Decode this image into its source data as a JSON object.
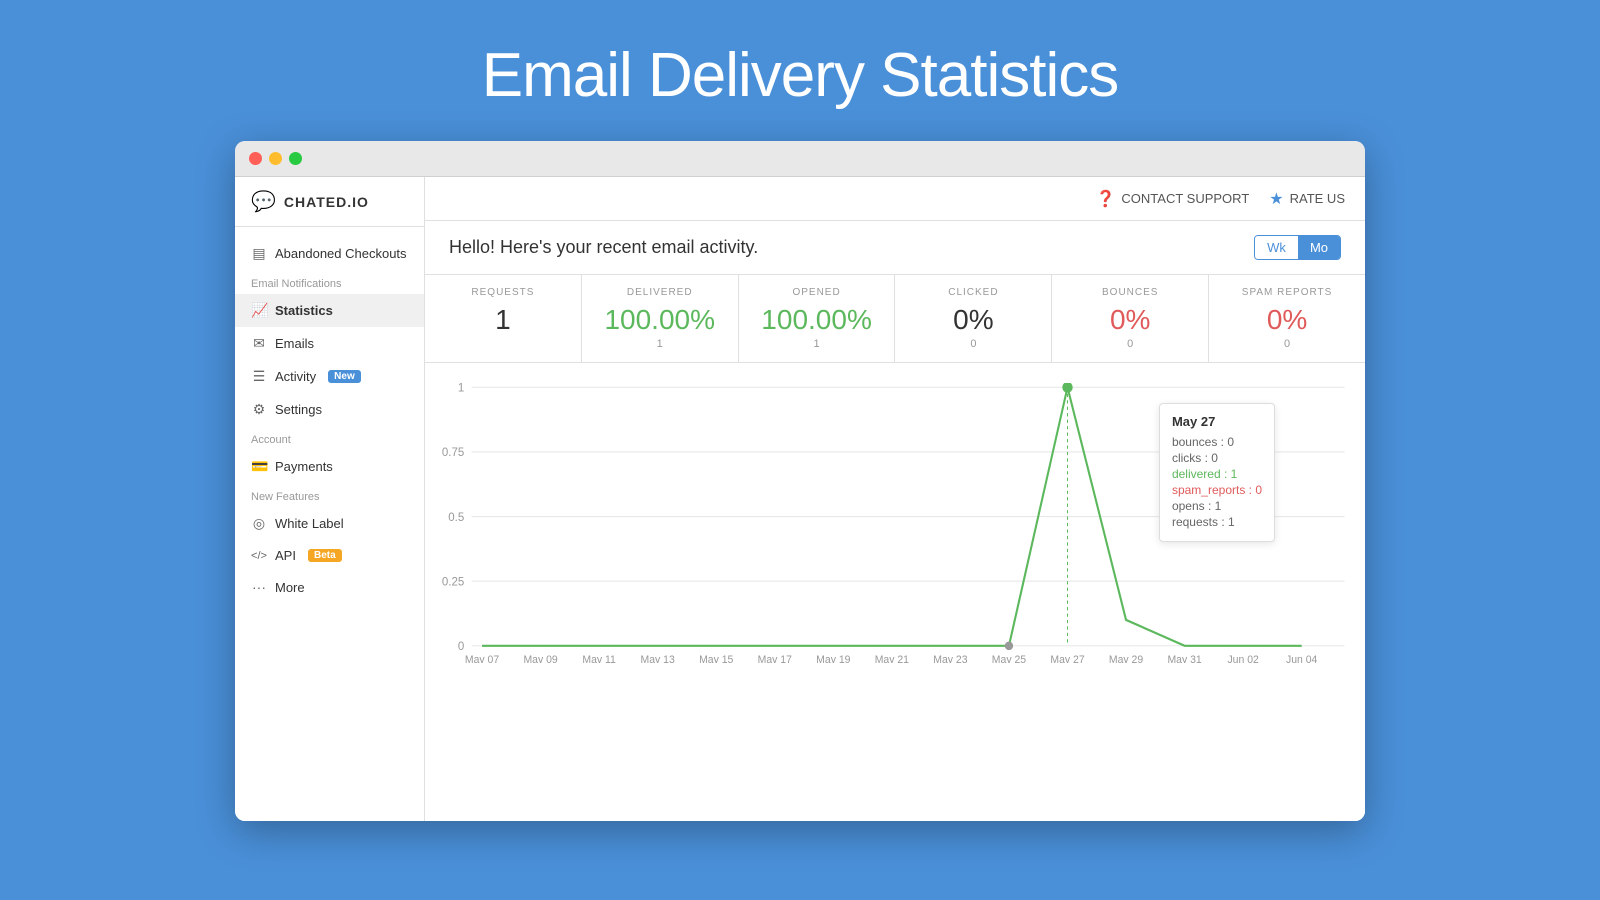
{
  "page": {
    "title": "Email Delivery Statistics"
  },
  "titlebar": {
    "lights": [
      "red",
      "yellow",
      "green"
    ]
  },
  "header": {
    "logo_text": "CHATED.IO",
    "contact_support_label": "CONTACT SUPPORT",
    "rate_us_label": "RATE US"
  },
  "sidebar": {
    "section_email": "Email Notifications",
    "section_account": "Account",
    "section_new_features": "New Features",
    "items": [
      {
        "id": "abandoned-checkouts",
        "label": "Abandoned Checkouts",
        "icon": "▤"
      },
      {
        "id": "statistics",
        "label": "Statistics",
        "icon": "📈",
        "active": true
      },
      {
        "id": "emails",
        "label": "Emails",
        "icon": "✉"
      },
      {
        "id": "activity",
        "label": "Activity",
        "icon": "☰",
        "badge": "New"
      },
      {
        "id": "settings",
        "label": "Settings",
        "icon": "⚙"
      },
      {
        "id": "payments",
        "label": "Payments",
        "icon": "💳"
      },
      {
        "id": "white-label",
        "label": "White Label",
        "icon": "◎"
      },
      {
        "id": "api",
        "label": "API",
        "icon": "</>",
        "badge": "Beta"
      },
      {
        "id": "more",
        "label": "More",
        "icon": "···"
      }
    ]
  },
  "content": {
    "greeting": "Hello! Here's your recent email activity.",
    "period_wk": "Wk",
    "period_mo": "Mo",
    "stats": [
      {
        "label": "REQUESTS",
        "value": "1",
        "sub": "",
        "color": "normal"
      },
      {
        "label": "DELIVERED",
        "value": "100.00%",
        "sub": "1",
        "color": "green"
      },
      {
        "label": "OPENED",
        "value": "100.00%",
        "sub": "1",
        "color": "green"
      },
      {
        "label": "CLICKED",
        "value": "0%",
        "sub": "0",
        "color": "normal"
      },
      {
        "label": "BOUNCES",
        "value": "0%",
        "sub": "0",
        "color": "red"
      },
      {
        "label": "SPAM REPORTS",
        "value": "0%",
        "sub": "0",
        "color": "red"
      }
    ],
    "chart": {
      "y_labels": [
        "1",
        "0.75",
        "0.5",
        "0.25",
        "0"
      ],
      "x_labels": [
        "May 07",
        "May 09",
        "May 11",
        "May 13",
        "May 15",
        "May 17",
        "May 19",
        "May 21",
        "May 23",
        "May 25",
        "May 27",
        "May 29",
        "May 31",
        "Jun 02",
        "Jun 04"
      ]
    },
    "tooltip": {
      "date": "May 27",
      "rows": [
        {
          "label": "bounces : 0",
          "color": "normal"
        },
        {
          "label": "clicks : 0",
          "color": "normal"
        },
        {
          "label": "delivered : 1",
          "color": "green"
        },
        {
          "label": "spam_reports : 0",
          "color": "pink"
        },
        {
          "label": "opens : 1",
          "color": "normal"
        },
        {
          "label": "requests : 1",
          "color": "normal"
        }
      ]
    }
  }
}
